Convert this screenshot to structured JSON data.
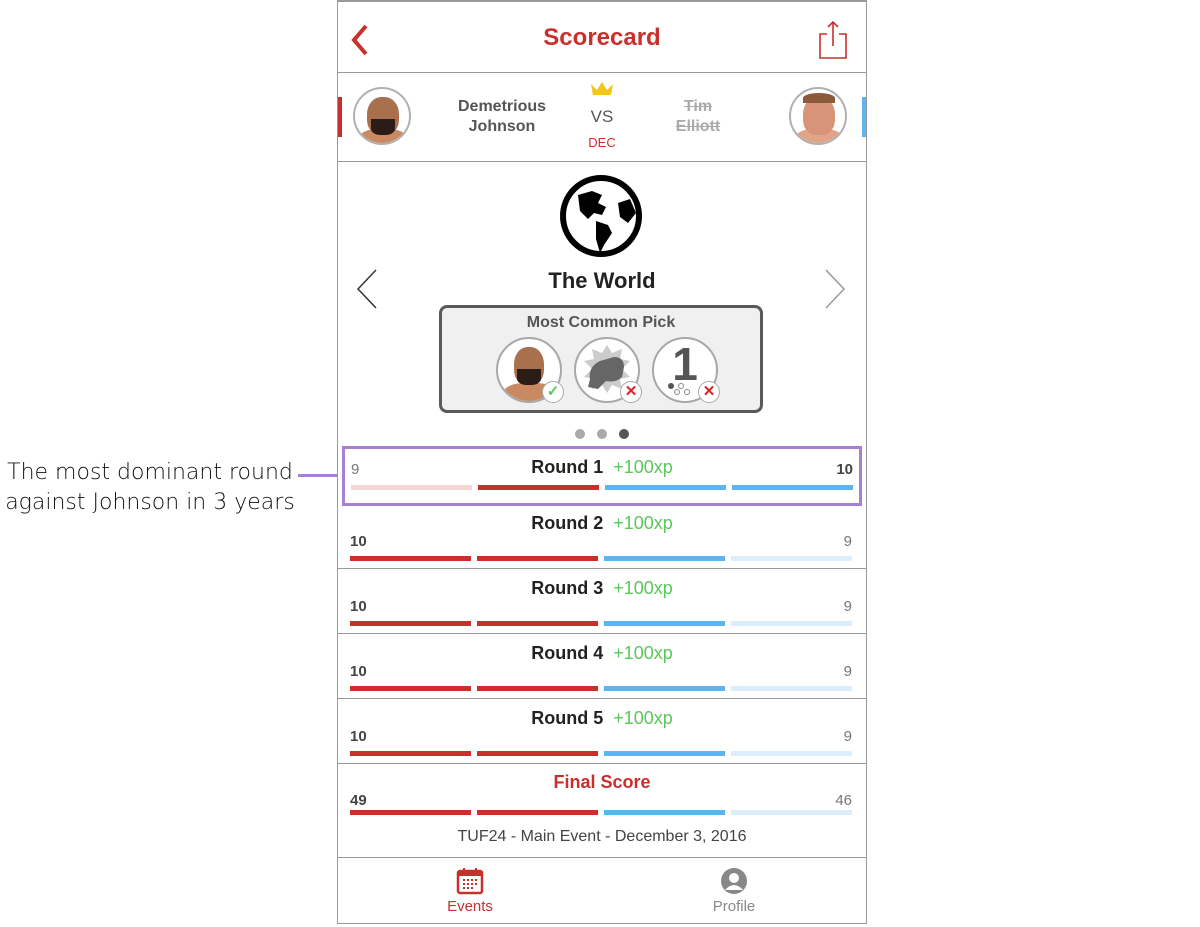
{
  "annotation": {
    "line1": "The most dominant round",
    "line2": "against Johnson in 3 years",
    "color": "#a77fd3"
  },
  "header": {
    "title": "Scorecard",
    "back_icon": "chevron-left-icon",
    "share_icon": "share-icon"
  },
  "fight": {
    "red_fighter": {
      "first": "Demetrious",
      "last": "Johnson",
      "winner": true
    },
    "blue_fighter": {
      "first": "Tim",
      "last": "Elliott",
      "winner": false
    },
    "vs": "VS",
    "method": "DEC",
    "winner_icon": "crown-icon"
  },
  "group": {
    "icon": "globe-icon",
    "name": "The World",
    "most_common_pick": {
      "title": "Most Common Pick",
      "picks": [
        {
          "type": "fighter",
          "value": "Demetrious Johnson",
          "correct": true
        },
        {
          "type": "method",
          "value": "KO/TKO",
          "correct": false
        },
        {
          "type": "round",
          "value": "1",
          "correct": false
        }
      ]
    },
    "page_count": 3,
    "active_page": 3
  },
  "rounds": [
    {
      "label": "Round 1",
      "xp": "+100xp",
      "red": "9",
      "blue": "10",
      "highlighted": true
    },
    {
      "label": "Round 2",
      "xp": "+100xp",
      "red": "10",
      "blue": "9",
      "highlighted": false
    },
    {
      "label": "Round 3",
      "xp": "+100xp",
      "red": "10",
      "blue": "9",
      "highlighted": false
    },
    {
      "label": "Round 4",
      "xp": "+100xp",
      "red": "10",
      "blue": "9",
      "highlighted": false
    },
    {
      "label": "Round 5",
      "xp": "+100xp",
      "red": "10",
      "blue": "9",
      "highlighted": false
    }
  ],
  "final": {
    "label": "Final Score",
    "red": "49",
    "blue": "46"
  },
  "event": "TUF24 - Main Event - December 3, 2016",
  "tabs": [
    {
      "label": "Events",
      "icon": "calendar-icon",
      "active": true
    },
    {
      "label": "Profile",
      "icon": "profile-icon",
      "active": false
    }
  ],
  "colors": {
    "red": "#c9302c",
    "blue": "#5fb3ef",
    "xp_green": "#5ac85a",
    "highlight": "#a77fd3"
  }
}
